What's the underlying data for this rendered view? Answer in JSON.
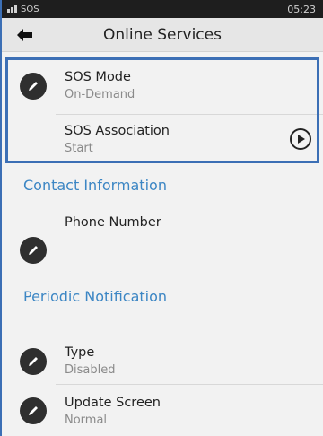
{
  "status_bar": {
    "app_label": "SOS",
    "time": "05:23",
    "network_icon": "network-icon"
  },
  "header": {
    "title": "Online Services",
    "back_icon": "back-arrow-icon"
  },
  "sos_group": {
    "mode": {
      "label": "SOS Mode",
      "value": "On-Demand",
      "icon": "edit-icon"
    },
    "association": {
      "label": "SOS Association",
      "value": "Start",
      "action_icon": "play-circle-icon"
    }
  },
  "contact_section": {
    "title": "Contact Information",
    "phone": {
      "label": "Phone Number",
      "icon": "edit-icon"
    }
  },
  "periodic_section": {
    "title": "Periodic Notification",
    "type": {
      "label": "Type",
      "value": "Disabled",
      "icon": "edit-icon"
    },
    "update_screen": {
      "label": "Update Screen",
      "value": "Normal",
      "icon": "edit-icon"
    }
  },
  "colors": {
    "accent": "#3c86c4",
    "highlight_border": "#3c6fb5",
    "icon_bg": "#2f2f2f",
    "status_bar_bg": "#1e1e1e"
  }
}
